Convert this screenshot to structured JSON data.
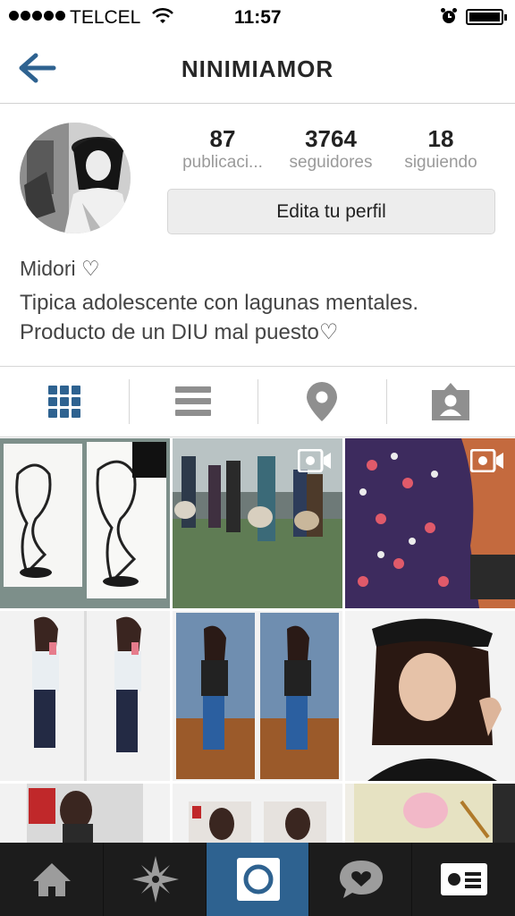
{
  "status_bar": {
    "carrier": "TELCEL",
    "time": "11:57"
  },
  "header": {
    "title": "NINIMIAMOR",
    "back_icon": "back-arrow-icon"
  },
  "profile": {
    "stats": [
      {
        "value": "87",
        "label": "publicaci..."
      },
      {
        "value": "3764",
        "label": "seguidores"
      },
      {
        "value": "18",
        "label": "siguiendo"
      }
    ],
    "edit_button": "Edita tu perfil",
    "name": "Midori ♡",
    "bio_line1": "Tipica adolescente con lagunas mentales.",
    "bio_line2": "Producto de un DIU mal puesto♡"
  },
  "view_tabs": [
    {
      "icon": "grid-icon",
      "active": true
    },
    {
      "icon": "list-icon",
      "active": false
    },
    {
      "icon": "location-pin-icon",
      "active": false
    },
    {
      "icon": "tagged-person-icon",
      "active": false
    }
  ],
  "grid": {
    "video_icon": "video-camera-icon"
  },
  "tabbar": [
    {
      "icon": "home-icon"
    },
    {
      "icon": "explore-star-icon"
    },
    {
      "icon": "camera-icon"
    },
    {
      "icon": "activity-heart-bubble-icon"
    },
    {
      "icon": "profile-card-icon"
    }
  ],
  "colors": {
    "accent": "#2e6290",
    "tabbar_bg": "#1c1c1c",
    "stat_label": "#9a9a9a"
  }
}
